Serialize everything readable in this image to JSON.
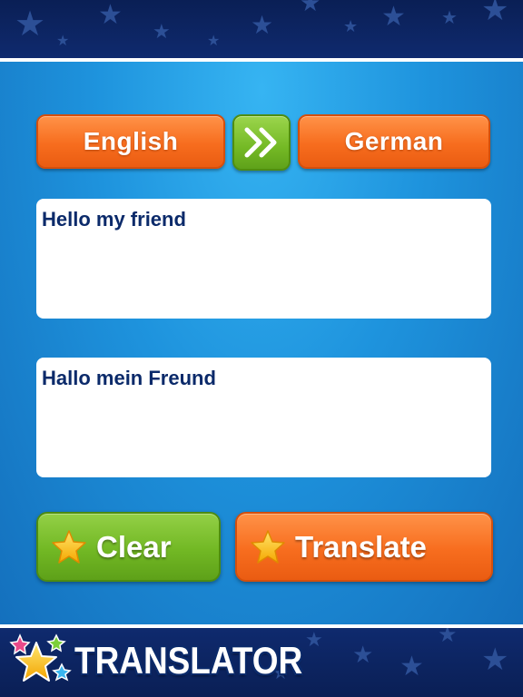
{
  "languages": {
    "source": "English",
    "target": "German",
    "swap_icon": "double-chevron-right-icon"
  },
  "input": {
    "text": "Hello my friend"
  },
  "output": {
    "text": "Hallo mein Freund"
  },
  "actions": {
    "clear_label": "Clear",
    "translate_label": "Translate",
    "star_icon": "star-icon"
  },
  "branding": {
    "logo_text": "TRANSLATOR"
  },
  "colors": {
    "orange": "#f76d1e",
    "green": "#74b925",
    "panel_blue": "#1e93dd",
    "navy": "#0d2460",
    "text_navy": "#0b2a6a"
  }
}
